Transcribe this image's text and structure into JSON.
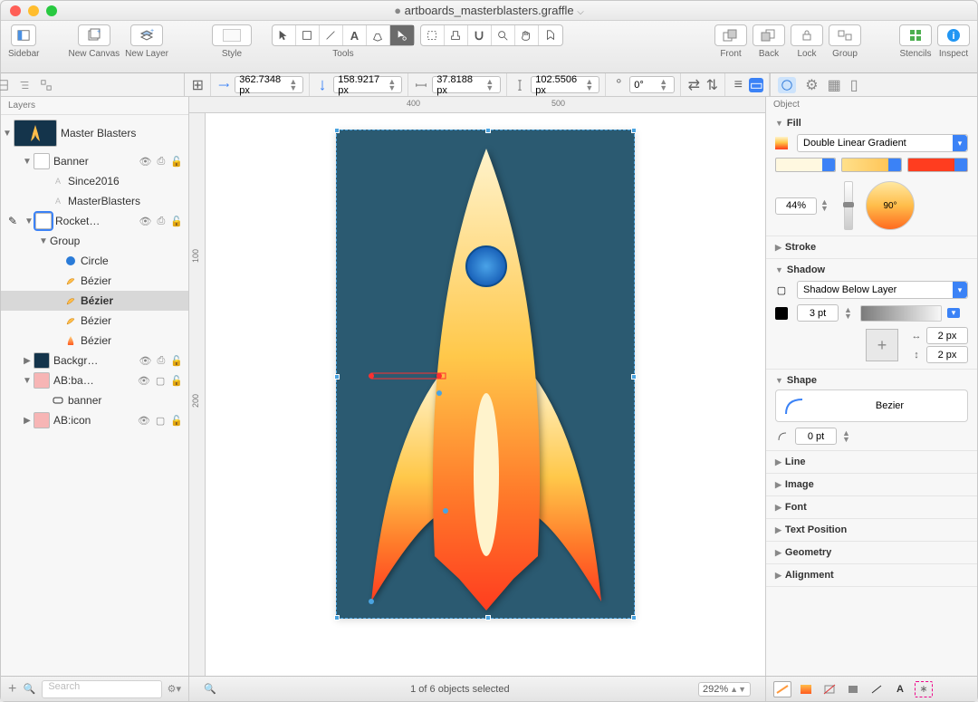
{
  "title": {
    "filename": "artboards_masterblasters.graffle",
    "dirty_marker": "●",
    "dropdown_marker": "⌵"
  },
  "toolbar": {
    "sidebar_label": "Sidebar",
    "new_canvas_label": "New Canvas",
    "new_layer_label": "New Layer",
    "style_label": "Style",
    "tools_label": "Tools",
    "front_label": "Front",
    "back_label": "Back",
    "lock_label": "Lock",
    "group_label": "Group",
    "stencils_label": "Stencils",
    "inspect_label": "Inspect"
  },
  "propbar": {
    "x": "362.7348 px",
    "y": "158.9217 px",
    "w": "37.8188 px",
    "h": "102.5506 px",
    "rotation": "0°"
  },
  "left": {
    "header": "Layers",
    "search_placeholder": "Search",
    "canvas_name": "Master Blasters",
    "items": [
      {
        "name": "Banner",
        "type": "layer",
        "indent": 1
      },
      {
        "name": "Since2016",
        "type": "text",
        "indent": 2
      },
      {
        "name": "MasterBlasters",
        "type": "text",
        "indent": 2
      },
      {
        "name": "Rocket…",
        "type": "layer",
        "indent": 1,
        "editing": true
      },
      {
        "name": "Group",
        "type": "group",
        "indent": 2
      },
      {
        "name": "Circle",
        "type": "shape-circle",
        "indent": 3
      },
      {
        "name": "Bézier",
        "type": "shape-bezier",
        "indent": 3
      },
      {
        "name": "Bézier",
        "type": "shape-bezier",
        "indent": 3,
        "selected": true,
        "bold": true
      },
      {
        "name": "Bézier",
        "type": "shape-bezier",
        "indent": 3
      },
      {
        "name": "Bézier",
        "type": "shape-bezier-body",
        "indent": 3
      },
      {
        "name": "Backgr…",
        "type": "layer-bg",
        "indent": 1
      },
      {
        "name": "AB:ba…",
        "type": "artboard",
        "indent": 1
      },
      {
        "name": "banner",
        "type": "rect",
        "indent": 2
      },
      {
        "name": "AB:icon",
        "type": "artboard",
        "indent": 1
      }
    ]
  },
  "inspector": {
    "header": "Object",
    "sections": {
      "fill": {
        "label": "Fill",
        "type": "Double Linear Gradient",
        "blend": "44%",
        "angle": "90°"
      },
      "stroke": {
        "label": "Stroke"
      },
      "shadow": {
        "label": "Shadow",
        "type": "Shadow Below Layer",
        "blur": "3 pt",
        "dx": "2 px",
        "dy": "2 px"
      },
      "shape": {
        "label": "Shape",
        "type": "Bezier",
        "corner": "0 pt"
      },
      "line": {
        "label": "Line"
      },
      "image": {
        "label": "Image"
      },
      "font": {
        "label": "Font"
      },
      "text_position": {
        "label": "Text Position"
      },
      "geometry": {
        "label": "Geometry"
      },
      "alignment": {
        "label": "Alignment"
      }
    }
  },
  "status": {
    "selection_text": "1 of 6 objects selected",
    "zoom": "292%"
  }
}
